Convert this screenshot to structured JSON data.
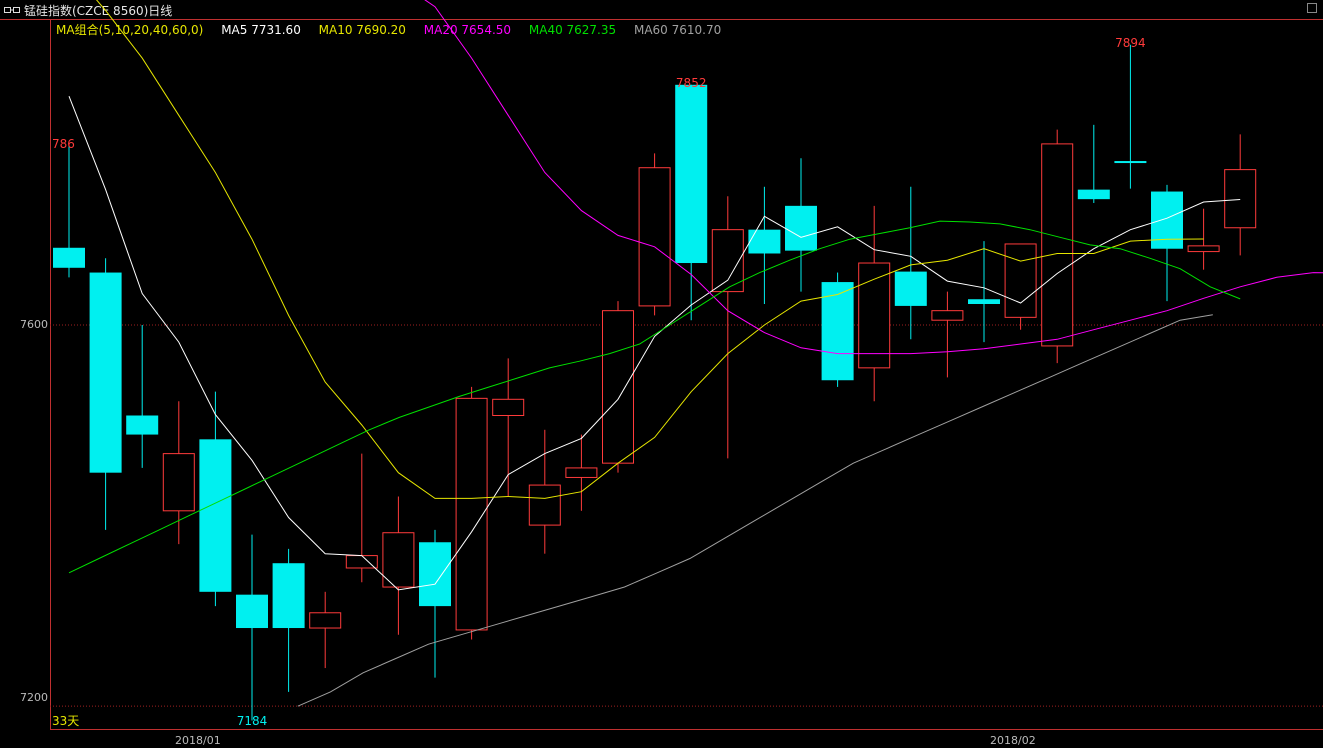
{
  "window": {
    "title": "锰硅指数(CZCE 8560)日线"
  },
  "legend": {
    "group": "MA组合(5,10,20,40,60,0)",
    "ma5": "MA5 7731.60",
    "ma10": "MA10 7690.20",
    "ma20": "MA20 7654.50",
    "ma40": "MA40 7627.35",
    "ma60": "MA60 7610.70"
  },
  "annotations": {
    "high_left": "786",
    "high_mid": "7852",
    "high_right": "7894",
    "low": "7184",
    "days": "33天"
  },
  "colors": {
    "up": "#ff3b3b",
    "down": "#00f0f0",
    "ma5": "#ffffff",
    "ma10": "#e6e600",
    "ma20": "#ff00ff",
    "ma40": "#00e000",
    "ma60": "#a0a0a0",
    "axis": "#c03030"
  },
  "chart_data": {
    "type": "candlestick",
    "title": "锰硅指数(CZCE 8560)日线",
    "x_labels": [
      "2018/01",
      "2018/02"
    ],
    "y_ticks": [
      "7600",
      "7200"
    ],
    "ylim": [
      7175,
      7920
    ],
    "candles": [
      {
        "o": 7681,
        "h": 7790,
        "l": 7650,
        "c": 7660
      },
      {
        "o": 7655,
        "h": 7670,
        "l": 7385,
        "c": 7445
      },
      {
        "o": 7505,
        "h": 7600,
        "l": 7450,
        "c": 7485
      },
      {
        "o": 7405,
        "h": 7520,
        "l": 7370,
        "c": 7465
      },
      {
        "o": 7480,
        "h": 7530,
        "l": 7305,
        "c": 7320
      },
      {
        "o": 7317,
        "h": 7380,
        "l": 7185,
        "c": 7282
      },
      {
        "o": 7350,
        "h": 7365,
        "l": 7215,
        "c": 7282
      },
      {
        "o": 7282,
        "h": 7320,
        "l": 7240,
        "c": 7298
      },
      {
        "o": 7345,
        "h": 7465,
        "l": 7330,
        "c": 7358
      },
      {
        "o": 7325,
        "h": 7420,
        "l": 7275,
        "c": 7382
      },
      {
        "o": 7372,
        "h": 7385,
        "l": 7230,
        "c": 7305
      },
      {
        "o": 7280,
        "h": 7535,
        "l": 7270,
        "c": 7523
      },
      {
        "o": 7505,
        "h": 7565,
        "l": 7420,
        "c": 7522
      },
      {
        "o": 7390,
        "h": 7490,
        "l": 7360,
        "c": 7432
      },
      {
        "o": 7440,
        "h": 7485,
        "l": 7405,
        "c": 7450
      },
      {
        "o": 7455,
        "h": 7625,
        "l": 7445,
        "c": 7615
      },
      {
        "o": 7620,
        "h": 7780,
        "l": 7610,
        "c": 7765
      },
      {
        "o": 7852,
        "h": 7852,
        "l": 7605,
        "c": 7665
      },
      {
        "o": 7635,
        "h": 7735,
        "l": 7460,
        "c": 7700
      },
      {
        "o": 7700,
        "h": 7745,
        "l": 7622,
        "c": 7675
      },
      {
        "o": 7725,
        "h": 7775,
        "l": 7635,
        "c": 7678
      },
      {
        "o": 7645,
        "h": 7655,
        "l": 7535,
        "c": 7542
      },
      {
        "o": 7555,
        "h": 7725,
        "l": 7520,
        "c": 7665
      },
      {
        "o": 7656,
        "h": 7745,
        "l": 7585,
        "c": 7620
      },
      {
        "o": 7605,
        "h": 7635,
        "l": 7545,
        "c": 7615
      },
      {
        "o": 7627,
        "h": 7688,
        "l": 7582,
        "c": 7622
      },
      {
        "o": 7608,
        "h": 7685,
        "l": 7595,
        "c": 7685
      },
      {
        "o": 7578,
        "h": 7805,
        "l": 7560,
        "c": 7790
      },
      {
        "o": 7742,
        "h": 7810,
        "l": 7728,
        "c": 7732
      },
      {
        "o": 7772,
        "h": 7894,
        "l": 7743,
        "c": 7770
      },
      {
        "o": 7740,
        "h": 7747,
        "l": 7625,
        "c": 7680
      },
      {
        "o": 7677,
        "h": 7722,
        "l": 7658,
        "c": 7683
      },
      {
        "o": 7702,
        "h": 7800,
        "l": 7673,
        "c": 7763
      }
    ],
    "series": [
      {
        "name": "MA5",
        "values": [
          7840,
          7742,
          7633,
          7582,
          7506,
          7458,
          7398,
          7360,
          7358,
          7322,
          7328,
          7383,
          7443,
          7465,
          7481,
          7522,
          7588,
          7621,
          7647,
          7714,
          7692,
          7703,
          7679,
          7672,
          7646,
          7639,
          7623,
          7654,
          7680,
          7700,
          7712,
          7729,
          7731.6
        ]
      },
      {
        "name": "MA10",
        "values": [
          7975,
          7930,
          7880,
          7820,
          7760,
          7690,
          7610,
          7540,
          7495,
          7445,
          7418,
          7418,
          7420,
          7418,
          7425,
          7455,
          7482,
          7530,
          7570,
          7600,
          7625,
          7632,
          7648,
          7663,
          7668,
          7680,
          7667,
          7675,
          7675,
          7688,
          7690,
          7690.2
        ]
      },
      {
        "name": "MA20",
        "values": [
          8000,
          7990,
          7985,
          7975,
          7960,
          7934,
          7880,
          7820,
          7760,
          7720,
          7694,
          7682,
          7653,
          7615,
          7592,
          7576,
          7570,
          7570,
          7570,
          7572,
          7575,
          7580,
          7585,
          7595,
          7605,
          7615,
          7628,
          7640,
          7650,
          7655,
          7654.5
        ]
      },
      {
        "name": "MA40",
        "values": [
          7340,
          7355,
          7370,
          7385,
          7400,
          7415,
          7430,
          7445,
          7460,
          7475,
          7490,
          7503,
          7514,
          7525,
          7535,
          7545,
          7555,
          7562,
          7570,
          7580,
          7600,
          7620,
          7640,
          7655,
          7668,
          7680,
          7690,
          7696,
          7702,
          7709,
          7708,
          7706,
          7700,
          7692,
          7684,
          7680,
          7670,
          7659,
          7640,
          7627.35
        ]
      },
      {
        "name": "MA60",
        "values": [
          7200,
          7215,
          7235,
          7250,
          7265,
          7275,
          7285,
          7295,
          7305,
          7315,
          7325,
          7340,
          7355,
          7375,
          7395,
          7415,
          7435,
          7455,
          7470,
          7485,
          7500,
          7515,
          7530,
          7545,
          7560,
          7575,
          7590,
          7605,
          7610.7
        ]
      }
    ]
  }
}
